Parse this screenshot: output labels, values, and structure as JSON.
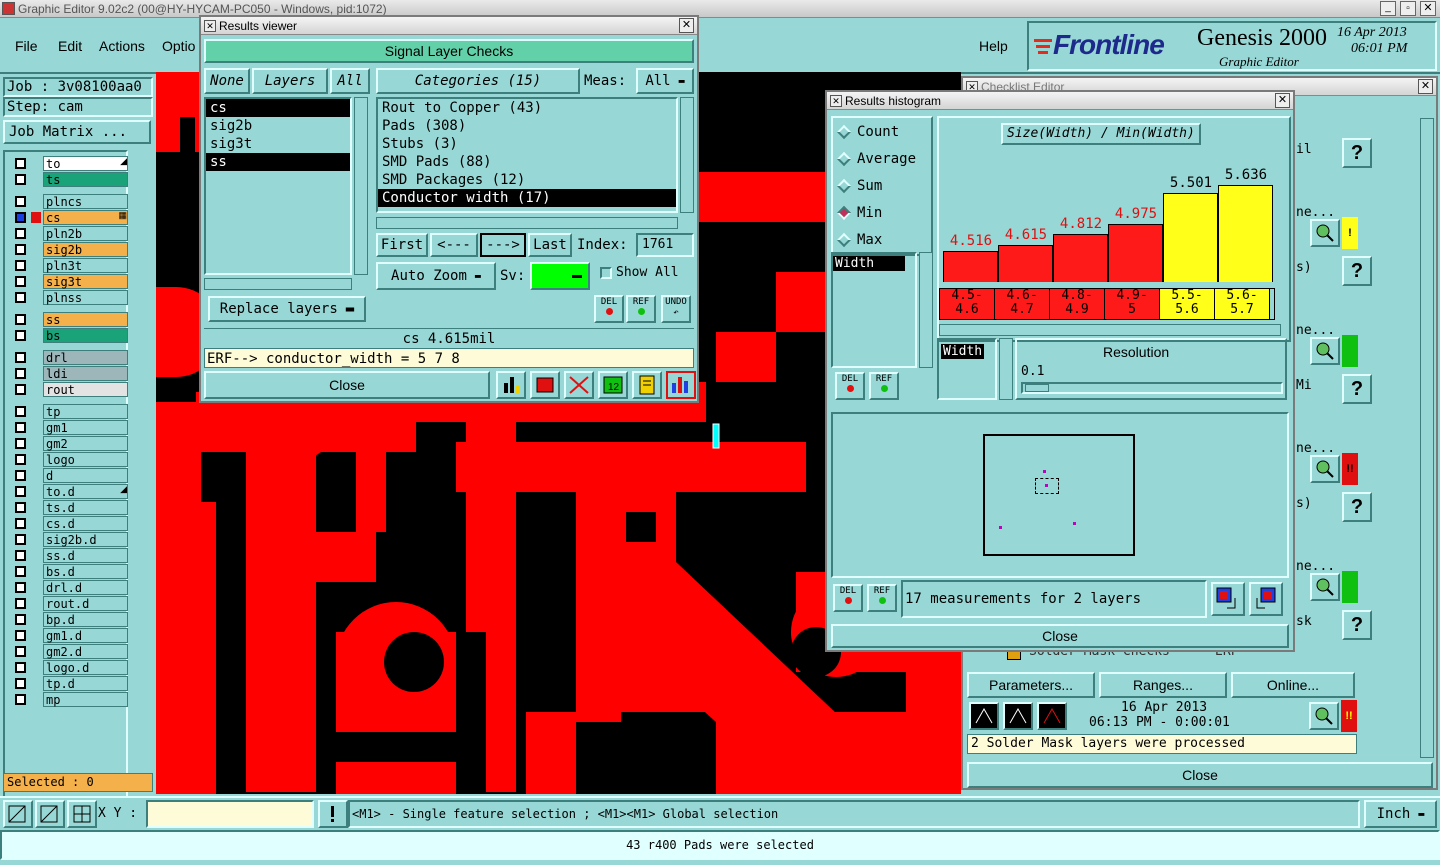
{
  "app": {
    "window_title": "Graphic Editor 9.02c2 (00@HY-HYCAM-PC050 - Windows, pid:1072)",
    "menu": [
      "File",
      "Edit",
      "Actions",
      "Optio"
    ],
    "help_label": "Help",
    "brand": "Frontline",
    "product": "Genesis 2000",
    "subtitle": "Graphic Editor",
    "date": "16 Apr 2013",
    "time": "06:01 PM"
  },
  "job_panel": {
    "job": "Job : 3v08100aa0",
    "step": "Step: cam",
    "job_matrix": "Job Matrix ...",
    "selected": "Selected : 0"
  },
  "layers": [
    {
      "name": "to",
      "color": "#ffffff",
      "mark": true
    },
    {
      "name": "ts",
      "color": "#1aa278"
    },
    {
      "name": "plncs",
      "color": "#97d7d5"
    },
    {
      "name": "cs",
      "color": "#f4b04a",
      "active": true,
      "mark2": true
    },
    {
      "name": "pln2b",
      "color": "#97d7d5"
    },
    {
      "name": "sig2b",
      "color": "#f4b04a"
    },
    {
      "name": "pln3t",
      "color": "#97d7d5"
    },
    {
      "name": "sig3t",
      "color": "#f4b04a"
    },
    {
      "name": "plnss",
      "color": "#97d7d5"
    },
    {
      "name": "ss",
      "color": "#f4b04a"
    },
    {
      "name": "bs",
      "color": "#1aa278"
    },
    {
      "name": "drl",
      "color": "#9db6b9"
    },
    {
      "name": "ldi",
      "color": "#9db6b9"
    },
    {
      "name": "rout",
      "color": "#e3e3e3"
    },
    {
      "name": "tp",
      "color": "#97d7d5"
    },
    {
      "name": "gm1",
      "color": "#97d7d5"
    },
    {
      "name": "gm2",
      "color": "#97d7d5"
    },
    {
      "name": "logo",
      "color": "#97d7d5"
    },
    {
      "name": "d",
      "color": "#97d7d5"
    },
    {
      "name": "to.d",
      "color": "#97d7d5",
      "mark": true
    },
    {
      "name": "ts.d",
      "color": "#97d7d5"
    },
    {
      "name": "cs.d",
      "color": "#97d7d5"
    },
    {
      "name": "sig2b.d",
      "color": "#97d7d5"
    },
    {
      "name": "ss.d",
      "color": "#97d7d5"
    },
    {
      "name": "bs.d",
      "color": "#97d7d5"
    },
    {
      "name": "drl.d",
      "color": "#97d7d5"
    },
    {
      "name": "rout.d",
      "color": "#97d7d5"
    },
    {
      "name": "bp.d",
      "color": "#97d7d5"
    },
    {
      "name": "gm1.d",
      "color": "#97d7d5"
    },
    {
      "name": "gm2.d",
      "color": "#97d7d5"
    },
    {
      "name": "logo.d",
      "color": "#97d7d5"
    },
    {
      "name": "tp.d",
      "color": "#97d7d5"
    },
    {
      "name": "mp",
      "color": "#97d7d5"
    }
  ],
  "results_viewer": {
    "title": "Results viewer",
    "header": "Signal Layer Checks",
    "none_label": "None",
    "layers_label": "Layers",
    "all_label": "All",
    "categories_label": "Categories (15)",
    "meas_label": "Meas:",
    "meas_value": "All",
    "layer_items": [
      "cs",
      "sig2b",
      "sig3t",
      "ss"
    ],
    "category_items": [
      "Rout to Copper (43)",
      "Pads (308)",
      "Stubs (3)",
      "SMD Pads (88)",
      "SMD Packages (12)",
      "Conductor width (17)"
    ],
    "first_label": "First",
    "prev_label": "<---",
    "next_label": "--->",
    "last_label": "Last",
    "index_label": "Index:",
    "index_value": "1761",
    "auto_zoom_label": "Auto Zoom",
    "sv_label": "Sv:",
    "show_all_label": "Show All",
    "replace_layers_label": "Replace layers",
    "del_label": "DEL",
    "ref_label": "REF",
    "undo_label": "UNDO",
    "status": "cs 4.615mil",
    "erf_line": "ERF--> conductor_width = 5 7 8",
    "close_label": "Close"
  },
  "histogram": {
    "title": "Results histogram",
    "modes": [
      "Count",
      "Average",
      "Sum",
      "Min",
      "Max"
    ],
    "selected_mode": "Min",
    "chart_title": "Size(Width) / Min(Width)",
    "list_item": "Width",
    "width_label": "Width",
    "resolution_label": "Resolution",
    "resolution_value": "0.1",
    "summary": "17 measurements for 2 layers",
    "del_label": "DEL",
    "ref_label": "REF",
    "close_label": "Close"
  },
  "chart_data": {
    "type": "bar",
    "categories": [
      "4.5-4.6",
      "4.6-4.7",
      "4.8-4.9",
      "4.9-5",
      "5.5-5.6",
      "5.6-5.7"
    ],
    "category_lines": [
      [
        "4.5-",
        "4.6"
      ],
      [
        "4.6-",
        "4.7"
      ],
      [
        "4.8-",
        "4.9"
      ],
      [
        "4.9-",
        "5"
      ],
      [
        "5.5-",
        "5.6"
      ],
      [
        "5.6-",
        "5.7"
      ]
    ],
    "values": [
      4.516,
      4.615,
      4.812,
      4.975,
      5.501,
      5.636
    ],
    "value_labels": [
      "4.516",
      "4.615",
      "4.812",
      "4.975",
      "5.501",
      "5.636"
    ],
    "colors": [
      "#ff1a1a",
      "#ff1a1a",
      "#ff1a1a",
      "#ff1a1a",
      "#ffff1a",
      "#ffff1a"
    ],
    "label_colors": [
      "#e01010",
      "#e01010",
      "#e01010",
      "#e01010",
      "#000000",
      "#000000"
    ],
    "title": "Size(Width) / Min(Width)"
  },
  "checklist": {
    "title": "Checklist Editor",
    "row_labels": [
      "il",
      "ne...",
      "s)",
      "ne...",
      "Mi",
      "ne...",
      "s)",
      "ne...",
      "sk"
    ],
    "solder_mask_text": "Solder Mask Checks",
    "erf_text": "ERF",
    "parameters_label": "Parameters...",
    "ranges_label": "Ranges...",
    "online_label": "Online...",
    "date": "16 Apr 2013",
    "time": "06:13 PM - 0:00:01",
    "result_text": "2 Solder Mask layers were processed",
    "close_label": "Close"
  },
  "bottom": {
    "xy_label": "X Y :",
    "hint": "<M1> - Single feature selection ; <M1><M1> Global selection",
    "unit": "Inch",
    "status": "43 r400 Pads were selected"
  }
}
